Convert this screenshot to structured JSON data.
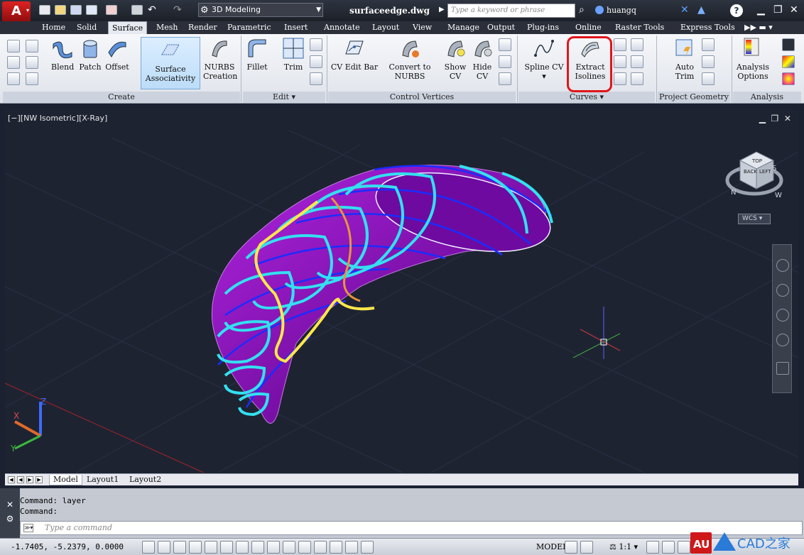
{
  "titlebar": {
    "app_button_label": "A",
    "workspace": "3D Modeling",
    "doc_title": "surfaceedge.dwg",
    "search_placeholder": "Type a keyword or phrase",
    "user": "huangq"
  },
  "menu_tabs": [
    "Home",
    "Solid",
    "Surface",
    "Mesh",
    "Render",
    "Parametric",
    "Insert",
    "Annotate",
    "Layout",
    "View",
    "Manage",
    "Output",
    "Plug-ins",
    "Online",
    "Raster Tools",
    "Express Tools"
  ],
  "active_tab": "Surface",
  "ribbon": {
    "create": {
      "title": "Create",
      "buttons": [
        "Blend",
        "Patch",
        "Offset"
      ],
      "surface_assoc_1": "Surface",
      "surface_assoc_2": "Associativity",
      "nurbs_1": "NURBS",
      "nurbs_2": "Creation"
    },
    "edit": {
      "title": "Edit",
      "buttons": [
        "Fillet",
        "Trim"
      ]
    },
    "control_vertices": {
      "title": "Control Vertices",
      "cv_edit_bar": "CV Edit Bar",
      "convert_1": "Convert to",
      "convert_2": "NURBS",
      "show_1": "Show",
      "show_2": "CV",
      "hide_1": "Hide",
      "hide_2": "CV"
    },
    "curves": {
      "title": "Curves",
      "spline_cv": "Spline CV",
      "extract_1": "Extract",
      "extract_2": "Isolines"
    },
    "project_geometry": {
      "title": "Project Geometry",
      "auto_1": "Auto",
      "auto_2": "Trim"
    },
    "analysis": {
      "title": "Analysis",
      "options_1": "Analysis",
      "options_2": "Options"
    }
  },
  "viewport": {
    "label": "[−][NW Isometric][X-Ray]",
    "wcs": "WCS",
    "cube_top": "TOP",
    "cube_back": "BACK",
    "cube_left": "LEFT",
    "compass_s": "S",
    "compass_n": "N",
    "compass_w": "W"
  },
  "layout_tabs": [
    "Model",
    "Layout1",
    "Layout2"
  ],
  "command": {
    "history": [
      "Command: layer",
      "Command:"
    ],
    "placeholder": "Type a command"
  },
  "status": {
    "coords": "-1.7405, -5.2379, 0.0000",
    "space": "MODEL",
    "scale": "1:1"
  },
  "watermark": {
    "au": "AU",
    "cad": "CAD之家"
  },
  "colors": {
    "surface": "#8a16b4",
    "isoline_cyan": "#33e0f0",
    "isoline_blue": "#1a2cff",
    "edge_yellow": "#ffe84a",
    "edge_orange": "#e7963a",
    "highlight_red": "#e0161b"
  }
}
